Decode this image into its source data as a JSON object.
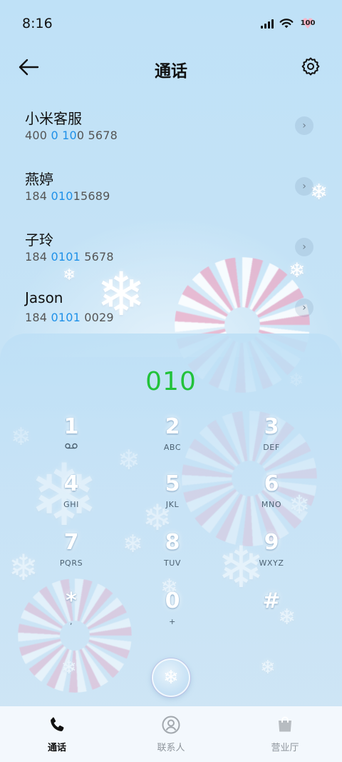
{
  "status": {
    "time": "8:16",
    "battery": "100"
  },
  "header": {
    "title": "通话",
    "back_icon": "arrow-left-icon",
    "settings_icon": "gear-icon"
  },
  "calls": [
    {
      "name": "小米客服",
      "number_parts": [
        "400 ",
        "0 10",
        "0 5678"
      ],
      "number": "400 100 5678"
    },
    {
      "name": "燕婷",
      "number_parts": [
        "184 ",
        "010",
        "15689"
      ],
      "number": "184 01015689"
    },
    {
      "name": "子玲",
      "number_parts": [
        "184 ",
        "0101",
        " 5678"
      ],
      "number": "184 0101 5678"
    },
    {
      "name": "Jason",
      "number_parts": [
        "184 ",
        "0101",
        " 0029"
      ],
      "number": "184 0101 0029"
    }
  ],
  "dialer": {
    "input": "010",
    "input_color": "#22c23a",
    "keys": [
      {
        "digit": "1",
        "letters": ""
      },
      {
        "digit": "2",
        "letters": "ABC"
      },
      {
        "digit": "3",
        "letters": "DEF"
      },
      {
        "digit": "4",
        "letters": "GHI"
      },
      {
        "digit": "5",
        "letters": "JKL"
      },
      {
        "digit": "6",
        "letters": "MNO"
      },
      {
        "digit": "7",
        "letters": "PQRS"
      },
      {
        "digit": "8",
        "letters": "TUV"
      },
      {
        "digit": "9",
        "letters": "WXYZ"
      },
      {
        "digit": "*",
        "letters": ","
      },
      {
        "digit": "0",
        "letters": "+"
      },
      {
        "digit": "#",
        "letters": ""
      }
    ],
    "call_icon": "snowflake-call-icon"
  },
  "nav": [
    {
      "label": "通话",
      "icon": "phone-icon",
      "active": true
    },
    {
      "label": "联系人",
      "icon": "contact-icon",
      "active": false
    },
    {
      "label": "营业厅",
      "icon": "shopping-bag-icon",
      "active": false
    }
  ],
  "colors": {
    "highlight": "#1e90e8",
    "accent_green": "#22c23a",
    "background": "#c6e3f6"
  }
}
